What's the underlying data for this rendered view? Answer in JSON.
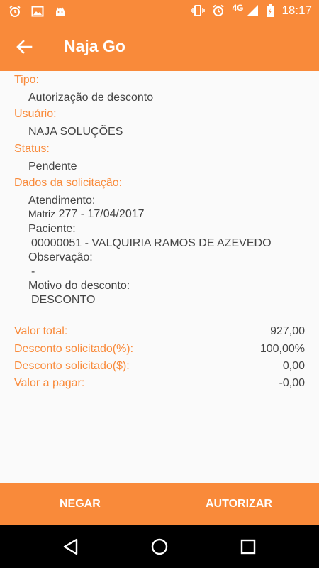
{
  "status_bar": {
    "network": "4G",
    "time": "18:17",
    "icons": [
      "alarm-icon",
      "image-icon",
      "android-icon",
      "vibrate-icon",
      "alarm-icon",
      "signal-icon",
      "battery-charging-icon"
    ]
  },
  "app_bar": {
    "title": "Naja Go",
    "back_icon": "arrow-left-icon"
  },
  "details": {
    "tipo_label": "Tipo:",
    "tipo_value": "Autorização de desconto",
    "usuario_label": "Usuário:",
    "usuario_value": "NAJA SOLUÇÕES",
    "status_label": "Status:",
    "status_value": "Pendente",
    "dados_label": "Dados da solicitação:",
    "atendimento_label": "Atendimento:",
    "atendimento_prefix": "Matriz",
    "atendimento_value": "277 - 17/04/2017",
    "paciente_label": "Paciente:",
    "paciente_value": "00000051 - VALQUIRIA RAMOS DE AZEVEDO",
    "observacao_label": "Observação:",
    "observacao_value": "-",
    "motivo_label": "Motivo do desconto:",
    "motivo_value": "DESCONTO"
  },
  "totals": [
    {
      "label": "Valor total:",
      "value": "927,00"
    },
    {
      "label": "Desconto solicitado(%):",
      "value": "100,00%"
    },
    {
      "label": "Desconto solicitado($):",
      "value": "0,00"
    },
    {
      "label": "Valor a pagar:",
      "value": "-0,00"
    }
  ],
  "actions": {
    "deny_label": "NEGAR",
    "authorize_label": "AUTORIZAR"
  },
  "nav_bar": {
    "icons": [
      "nav-back-icon",
      "nav-home-icon",
      "nav-recents-icon"
    ]
  },
  "colors": {
    "accent": "#f98a3a",
    "text": "#444444",
    "background": "#fafafa"
  }
}
